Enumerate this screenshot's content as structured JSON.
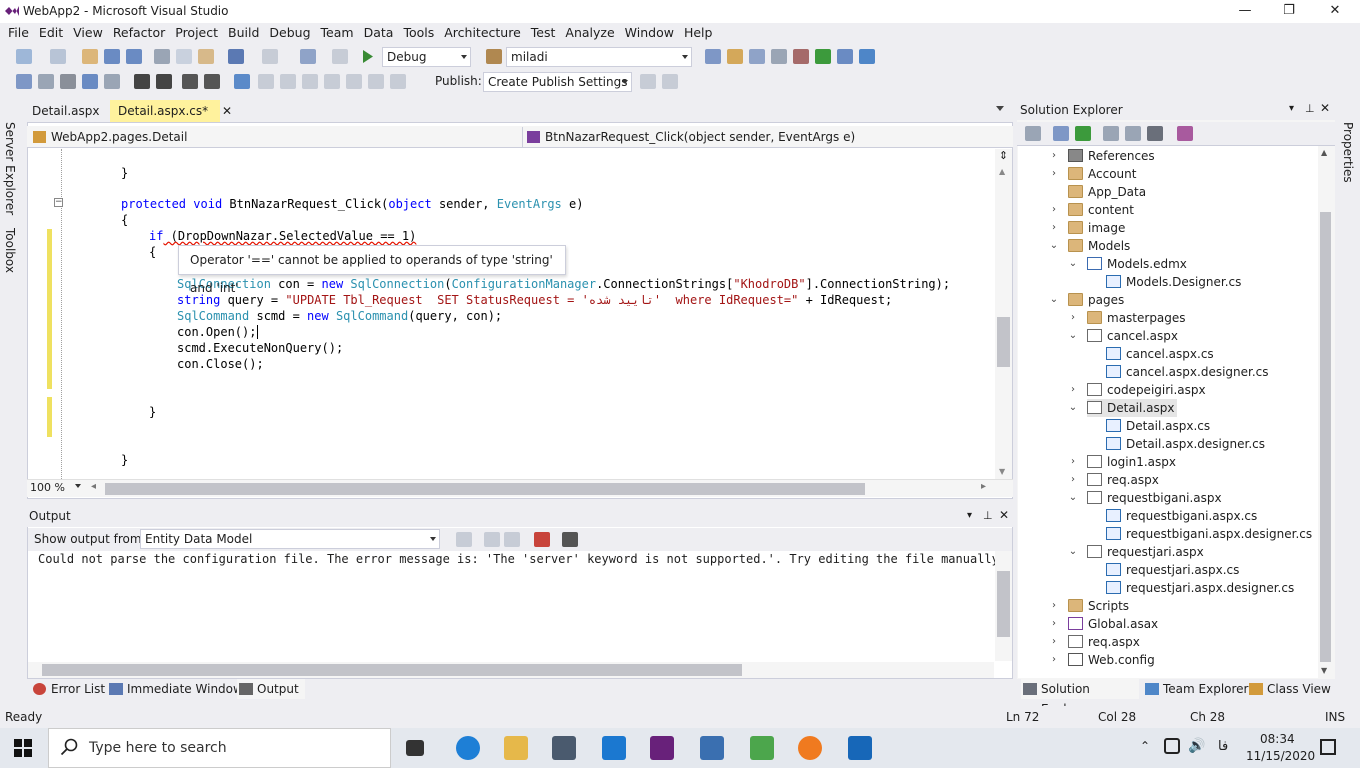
{
  "window": {
    "title": "WebApp2 - Microsoft Visual Studio",
    "minimize": "—",
    "maximize": "❐",
    "close": "✕"
  },
  "menu": [
    "File",
    "Edit",
    "View",
    "Refactor",
    "Project",
    "Build",
    "Debug",
    "Team",
    "Data",
    "Tools",
    "Architecture",
    "Test",
    "Analyze",
    "Window",
    "Help"
  ],
  "toolbar1": {
    "config": "Debug",
    "user": "miladi"
  },
  "toolbar2": {
    "publish_label": "Publish:",
    "publish_value": "Create Publish Settings"
  },
  "side_tabs": {
    "server_explorer": "Server Explorer",
    "toolbox": "Toolbox",
    "properties": "Properties"
  },
  "tabs": [
    {
      "label": "Detail.aspx"
    },
    {
      "label": "Detail.aspx.cs*",
      "close": "✕"
    }
  ],
  "nav": {
    "class_combo": "WebApp2.pages.Detail",
    "member_combo": "BtnNazarRequest_Click(object sender, EventArgs e)"
  },
  "code": {
    "l1": "}",
    "l2_kw1": "protected",
    "l2_kw2": "void",
    "l2_name": "BtnNazarRequest_Click(",
    "l2_kw3": "object",
    "l2_mid": " sender, ",
    "l2_ty": "EventArgs",
    "l2_end": " e)",
    "l3": "{",
    "l4_kw": "if",
    "l4_rest": " (DropDownNazar.SelectedValue == 1)",
    "l5": "{",
    "l6_ty1": "SqlConnection",
    "l6_mid1": " con = ",
    "l6_kw": "new",
    "l6_ty2": " SqlConnection",
    "l6_p": "(",
    "l6_ty3": "ConfigurationManager",
    "l6_mid2": ".ConnectionStrings[",
    "l6_str": "\"KhodroDB\"",
    "l6_end": "].ConnectionString);",
    "l7_kw": "string",
    "l7_mid": " query = ",
    "l7_str": "\"UPDATE Tbl_Request  SET StatusRequest = 'تایید شده'  where IdRequest=\"",
    "l7_end": " + IdRequest;",
    "l8_ty1": "SqlCommand",
    "l8_mid": " scmd = ",
    "l8_kw": "new",
    "l8_ty2": " SqlCommand",
    "l8_end": "(query, con);",
    "l9": "con.Open();",
    "l10": "scmd.ExecuteNonQuery();",
    "l11": "con.Close();",
    "l12": "}",
    "l13": "}"
  },
  "tooltip": "Operator '==' cannot be applied to operands of type 'string' and 'int'",
  "zoom": "100 %",
  "output": {
    "title": "Output",
    "show_from_label": "Show output from:",
    "source": "Entity Data Model",
    "text": "Could not parse the configuration file. The error message is: 'The 'server' keyword is not supported.'. Try editing the file manually and"
  },
  "bottom_tabs": [
    "Error List",
    "Immediate Window",
    "Output"
  ],
  "solution_explorer": {
    "title": "Solution Explorer",
    "items": [
      {
        "label": "References",
        "icon": "references-icon",
        "chev": "›"
      },
      {
        "label": "Account",
        "icon": "folder-icon",
        "chev": "›"
      },
      {
        "label": "App_Data",
        "icon": "folder-icon",
        "chev": ""
      },
      {
        "label": "content",
        "icon": "folder-icon",
        "chev": "›"
      },
      {
        "label": "image",
        "icon": "folder-icon",
        "chev": "›"
      },
      {
        "label": "Models",
        "icon": "folder-icon",
        "chev": "⌄"
      },
      {
        "label": "Models.edmx",
        "icon": "edmx-icon",
        "chev": "⌄"
      },
      {
        "label": "Models.Designer.cs",
        "icon": "cs-file-icon",
        "chev": ""
      },
      {
        "label": "pages",
        "icon": "folder-icon",
        "chev": "⌄"
      },
      {
        "label": "masterpages",
        "icon": "folder-icon",
        "chev": "›"
      },
      {
        "label": "cancel.aspx",
        "icon": "aspx-file-icon",
        "chev": "⌄"
      },
      {
        "label": "cancel.aspx.cs",
        "icon": "cs-file-icon",
        "chev": ""
      },
      {
        "label": "cancel.aspx.designer.cs",
        "icon": "cs-file-icon",
        "chev": ""
      },
      {
        "label": "codepeigiri.aspx",
        "icon": "aspx-file-icon",
        "chev": "›"
      },
      {
        "label": "Detail.aspx",
        "icon": "aspx-file-icon",
        "chev": "⌄"
      },
      {
        "label": "Detail.aspx.cs",
        "icon": "cs-file-icon",
        "chev": ""
      },
      {
        "label": "Detail.aspx.designer.cs",
        "icon": "cs-file-icon",
        "chev": ""
      },
      {
        "label": "login1.aspx",
        "icon": "aspx-file-icon",
        "chev": "›"
      },
      {
        "label": "req.aspx",
        "icon": "aspx-file-icon",
        "chev": "›"
      },
      {
        "label": "requestbigani.aspx",
        "icon": "aspx-file-icon",
        "chev": "⌄"
      },
      {
        "label": "requestbigani.aspx.cs",
        "icon": "cs-file-icon",
        "chev": ""
      },
      {
        "label": "requestbigani.aspx.designer.cs",
        "icon": "cs-file-icon",
        "chev": ""
      },
      {
        "label": "requestjari.aspx",
        "icon": "aspx-file-icon",
        "chev": "⌄"
      },
      {
        "label": "requestjari.aspx.cs",
        "icon": "cs-file-icon",
        "chev": ""
      },
      {
        "label": "requestjari.aspx.designer.cs",
        "icon": "cs-file-icon",
        "chev": ""
      },
      {
        "label": "Scripts",
        "icon": "folder-icon",
        "chev": "›"
      },
      {
        "label": "Global.asax",
        "icon": "asax-file-icon",
        "chev": "›"
      },
      {
        "label": "req.aspx",
        "icon": "aspx-file-icon",
        "chev": "›"
      },
      {
        "label": "Web.config",
        "icon": "config-file-icon",
        "chev": "›"
      }
    ],
    "tabs": [
      "Solution Explorer",
      "Team Explorer",
      "Class View"
    ]
  },
  "status": {
    "ready": "Ready",
    "ln": "Ln 72",
    "col": "Col 28",
    "ch": "Ch 28",
    "mode": "INS"
  },
  "taskbar": {
    "search_placeholder": "Type here to search",
    "time": "08:34",
    "date": "11/15/2020",
    "lang": "فا"
  },
  "colors": {
    "accent": "#007ACC",
    "tab_active": "#FFF29D",
    "keyword": "#0000FF",
    "type": "#2B91AF",
    "string": "#A31515"
  }
}
